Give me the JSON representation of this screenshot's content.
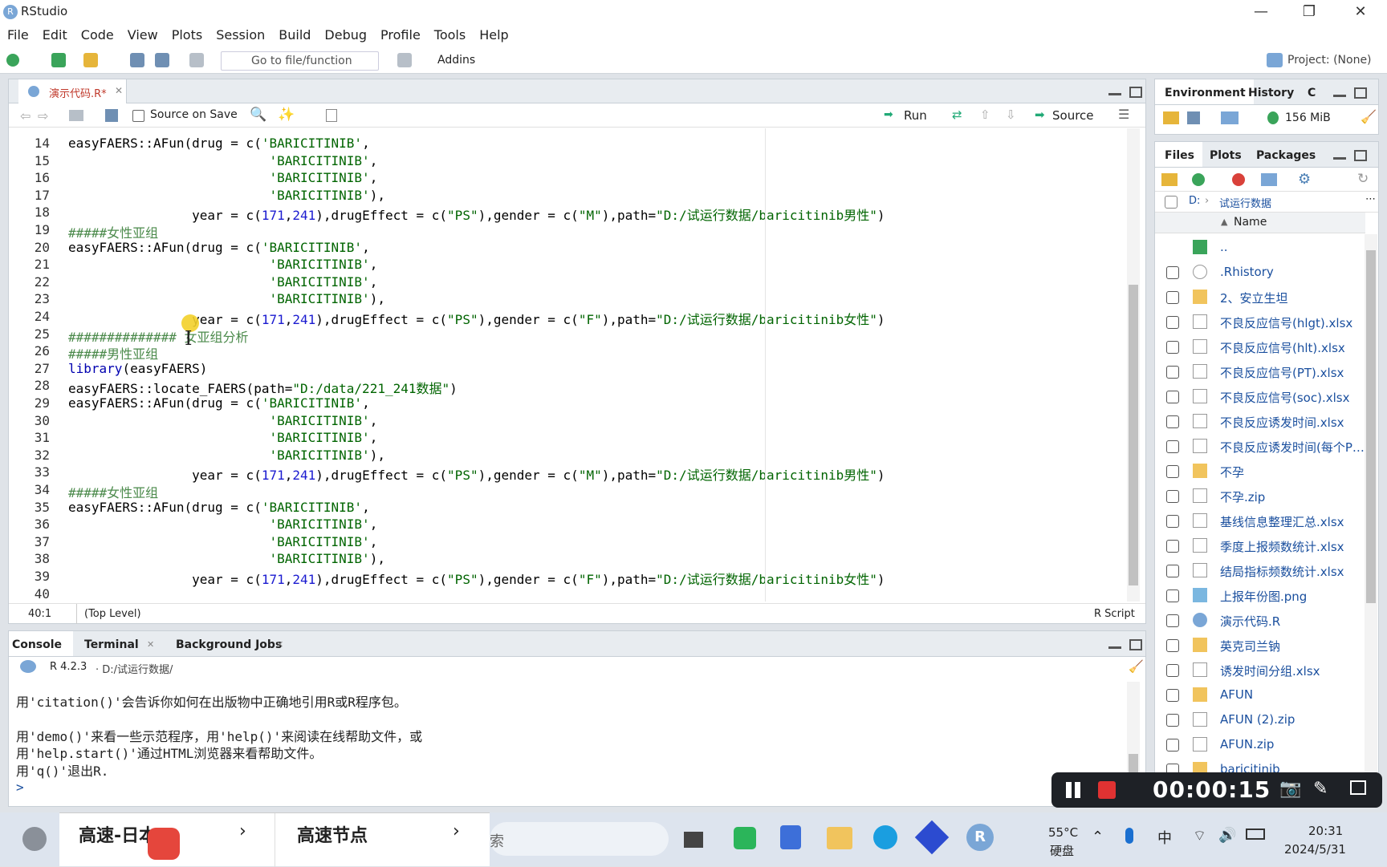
{
  "window": {
    "title": "RStudio",
    "minimize": "—",
    "restore": "❐",
    "close": "✕"
  },
  "menu": [
    "File",
    "Edit",
    "Code",
    "View",
    "Plots",
    "Session",
    "Build",
    "Debug",
    "Profile",
    "Tools",
    "Help"
  ],
  "toolbar": {
    "goto_placeholder": "Go to file/function",
    "addins": "Addins",
    "project": "Project: (None)"
  },
  "editor": {
    "tab_name": "演示代码.R*",
    "source_on_save": "Source on Save",
    "run": "Run",
    "source": "Source",
    "status_pos": "40:1",
    "status_scope": "(Top Level)",
    "status_type": "R Script",
    "lines": [
      {
        "n": "14",
        "segs": [
          [
            "",
            "easyFAERS::AFun(drug = c("
          ],
          [
            "str",
            "'BARICITINIB'"
          ],
          [
            "",
            ","
          ]
        ]
      },
      {
        "n": "15",
        "segs": [
          [
            "",
            "                          "
          ],
          [
            "str",
            "'BARICITINIB'"
          ],
          [
            "",
            ","
          ]
        ]
      },
      {
        "n": "16",
        "segs": [
          [
            "",
            "                          "
          ],
          [
            "str",
            "'BARICITINIB'"
          ],
          [
            "",
            ","
          ]
        ]
      },
      {
        "n": "17",
        "segs": [
          [
            "",
            "                          "
          ],
          [
            "str",
            "'BARICITINIB'"
          ],
          [
            "",
            "),"
          ]
        ]
      },
      {
        "n": "18",
        "segs": [
          [
            "",
            "                year = c("
          ],
          [
            "num",
            "171"
          ],
          [
            "",
            ","
          ],
          [
            "num",
            "241"
          ],
          [
            "",
            "),drugEffect = c("
          ],
          [
            "str",
            "\"PS\""
          ],
          [
            "",
            "),gender = c("
          ],
          [
            "str",
            "\"M\""
          ],
          [
            "",
            "),path="
          ],
          [
            "str",
            "\"D:/试运行数据/baricitinib男性\""
          ],
          [
            "",
            ")"
          ]
        ]
      },
      {
        "n": "19",
        "segs": [
          [
            "cm",
            "#####女性亚组"
          ]
        ]
      },
      {
        "n": "20",
        "segs": [
          [
            "",
            "easyFAERS::AFun(drug = c("
          ],
          [
            "str",
            "'BARICITINIB'"
          ],
          [
            "",
            ","
          ]
        ]
      },
      {
        "n": "21",
        "segs": [
          [
            "",
            "                          "
          ],
          [
            "str",
            "'BARICITINIB'"
          ],
          [
            "",
            ","
          ]
        ]
      },
      {
        "n": "22",
        "segs": [
          [
            "",
            "                          "
          ],
          [
            "str",
            "'BARICITINIB'"
          ],
          [
            "",
            ","
          ]
        ]
      },
      {
        "n": "23",
        "segs": [
          [
            "",
            "                          "
          ],
          [
            "str",
            "'BARICITINIB'"
          ],
          [
            "",
            "),"
          ]
        ]
      },
      {
        "n": "24",
        "segs": [
          [
            "",
            "                year = c("
          ],
          [
            "num",
            "171"
          ],
          [
            "",
            ","
          ],
          [
            "num",
            "241"
          ],
          [
            "",
            "),drugEffect = c("
          ],
          [
            "str",
            "\"PS\""
          ],
          [
            "",
            "),gender = c("
          ],
          [
            "str",
            "\"F\""
          ],
          [
            "",
            "),path="
          ],
          [
            "str",
            "\"D:/试运行数据/baricitinib女性\""
          ],
          [
            "",
            ")"
          ]
        ]
      },
      {
        "n": "25",
        "segs": [
          [
            "cm",
            "############## 女亚组分析"
          ]
        ]
      },
      {
        "n": "26",
        "segs": [
          [
            "cm",
            "#####男性亚组"
          ]
        ]
      },
      {
        "n": "27",
        "segs": [
          [
            "kw",
            "library"
          ],
          [
            "",
            "(easyFAERS)"
          ]
        ]
      },
      {
        "n": "28",
        "segs": [
          [
            "",
            "easyFAERS::locate_FAERS(path="
          ],
          [
            "str",
            "\"D:/data/221_241数据\""
          ],
          [
            "",
            ")"
          ]
        ]
      },
      {
        "n": "29",
        "segs": [
          [
            "",
            "easyFAERS::AFun(drug = c("
          ],
          [
            "str",
            "'BARICITINIB'"
          ],
          [
            "",
            ","
          ]
        ]
      },
      {
        "n": "30",
        "segs": [
          [
            "",
            "                          "
          ],
          [
            "str",
            "'BARICITINIB'"
          ],
          [
            "",
            ","
          ]
        ]
      },
      {
        "n": "31",
        "segs": [
          [
            "",
            "                          "
          ],
          [
            "str",
            "'BARICITINIB'"
          ],
          [
            "",
            ","
          ]
        ]
      },
      {
        "n": "32",
        "segs": [
          [
            "",
            "                          "
          ],
          [
            "str",
            "'BARICITINIB'"
          ],
          [
            "",
            "),"
          ]
        ]
      },
      {
        "n": "33",
        "segs": [
          [
            "",
            "                year = c("
          ],
          [
            "num",
            "171"
          ],
          [
            "",
            ","
          ],
          [
            "num",
            "241"
          ],
          [
            "",
            "),drugEffect = c("
          ],
          [
            "str",
            "\"PS\""
          ],
          [
            "",
            "),gender = c("
          ],
          [
            "str",
            "\"M\""
          ],
          [
            "",
            "),path="
          ],
          [
            "str",
            "\"D:/试运行数据/baricitinib男性\""
          ],
          [
            "",
            ")"
          ]
        ]
      },
      {
        "n": "34",
        "segs": [
          [
            "cm",
            "#####女性亚组"
          ]
        ]
      },
      {
        "n": "35",
        "segs": [
          [
            "",
            "easyFAERS::AFun(drug = c("
          ],
          [
            "str",
            "'BARICITINIB'"
          ],
          [
            "",
            ","
          ]
        ]
      },
      {
        "n": "36",
        "segs": [
          [
            "",
            "                          "
          ],
          [
            "str",
            "'BARICITINIB'"
          ],
          [
            "",
            ","
          ]
        ]
      },
      {
        "n": "37",
        "segs": [
          [
            "",
            "                          "
          ],
          [
            "str",
            "'BARICITINIB'"
          ],
          [
            "",
            ","
          ]
        ]
      },
      {
        "n": "38",
        "segs": [
          [
            "",
            "                          "
          ],
          [
            "str",
            "'BARICITINIB'"
          ],
          [
            "",
            "),"
          ]
        ]
      },
      {
        "n": "39",
        "segs": [
          [
            "",
            "                year = c("
          ],
          [
            "num",
            "171"
          ],
          [
            "",
            ","
          ],
          [
            "num",
            "241"
          ],
          [
            "",
            "),drugEffect = c("
          ],
          [
            "str",
            "\"PS\""
          ],
          [
            "",
            "),gender = c("
          ],
          [
            "str",
            "\"F\""
          ],
          [
            "",
            "),path="
          ],
          [
            "str",
            "\"D:/试运行数据/baricitinib女性\""
          ],
          [
            "",
            ")"
          ]
        ]
      },
      {
        "n": "40",
        "segs": []
      }
    ]
  },
  "console": {
    "tabs": [
      "Console",
      "Terminal",
      "Background Jobs"
    ],
    "version": "R 4.2.3",
    "path": "· D:/试运行数据/",
    "lines": [
      "用'citation()'会告诉你如何在出版物中正确地引用R或R程序包。",
      "",
      "用'demo()'来看一些示范程序，用'help()'来阅读在线帮助文件，或",
      "用'help.start()'通过HTML浏览器来看帮助文件。",
      "用'q()'退出R."
    ],
    "prompt": ">"
  },
  "env": {
    "tabs": [
      "Environment",
      "History",
      "C"
    ],
    "memory": "156 MiB"
  },
  "files": {
    "tabs": [
      "Files",
      "Plots",
      "Packages"
    ],
    "path_root": "D:",
    "path_dir": "试运行数据",
    "col_name": "Name",
    "items": [
      {
        "name": "..",
        "type": "up"
      },
      {
        "name": ".Rhistory",
        "type": "hist"
      },
      {
        "name": "2、安立生坦",
        "type": "folder"
      },
      {
        "name": "不良反应信号(hlgt).xlsx",
        "type": "doc"
      },
      {
        "name": "不良反应信号(hlt).xlsx",
        "type": "doc"
      },
      {
        "name": "不良反应信号(PT).xlsx",
        "type": "doc"
      },
      {
        "name": "不良反应信号(soc).xlsx",
        "type": "doc"
      },
      {
        "name": "不良反应诱发时间.xlsx",
        "type": "doc"
      },
      {
        "name": "不良反应诱发时间(每个P…",
        "type": "doc"
      },
      {
        "name": "不孕",
        "type": "folder"
      },
      {
        "name": "不孕.zip",
        "type": "doc"
      },
      {
        "name": "基线信息整理汇总.xlsx",
        "type": "doc"
      },
      {
        "name": "季度上报频数统计.xlsx",
        "type": "doc"
      },
      {
        "name": "结局指标频数统计.xlsx",
        "type": "doc"
      },
      {
        "name": "上报年份图.png",
        "type": "img"
      },
      {
        "name": "演示代码.R",
        "type": "r"
      },
      {
        "name": "英克司兰钠",
        "type": "folder"
      },
      {
        "name": "诱发时间分组.xlsx",
        "type": "doc"
      },
      {
        "name": "AFUN",
        "type": "folder"
      },
      {
        "name": "AFUN (2).zip",
        "type": "doc"
      },
      {
        "name": "AFUN.zip",
        "type": "doc"
      },
      {
        "name": "baricitinib",
        "type": "folder"
      }
    ]
  },
  "recorder": {
    "time": "00:00:15"
  },
  "taskbar": {
    "item1": "高速-日本2",
    "item2": "高速节点",
    "search_partial": "索",
    "temp": "55°C",
    "disk": "硬盘",
    "ime": "中",
    "time": "20:31",
    "date": "2024/5/31"
  }
}
